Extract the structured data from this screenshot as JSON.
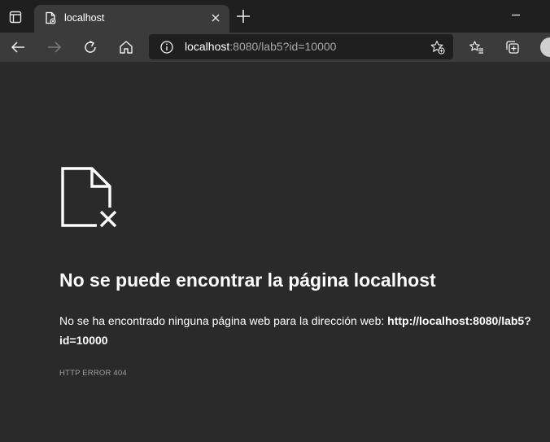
{
  "tab": {
    "title": "localhost"
  },
  "address_bar": {
    "host": "localhost",
    "rest": ":8080/lab5?id=10000"
  },
  "error": {
    "heading": "No se puede encontrar la página localhost",
    "description": "No se ha encontrado ninguna página web para la dirección web: ",
    "url": "http://localhost:8080/lab5?id=10000",
    "code": "HTTP ERROR 404"
  },
  "icons": {
    "tab_actions": "tab-actions-icon",
    "favicon": "document-error-icon",
    "tab_close": "close-icon",
    "new_tab": "plus-icon",
    "minimize": "minimize-icon",
    "back": "back-arrow-icon",
    "forward": "forward-arrow-icon",
    "refresh": "refresh-icon",
    "home": "home-icon",
    "site_info": "info-icon",
    "add_favorite": "star-plus-icon",
    "favorites": "favorites-icon",
    "collections": "collections-icon",
    "profile": "avatar",
    "page_error": "document-error-icon"
  },
  "colors": {
    "tabstrip": "#1f1f1f",
    "toolbar": "#3b3b3b",
    "page_background": "#2a2a2b",
    "muted_text": "#a8a8a8"
  }
}
